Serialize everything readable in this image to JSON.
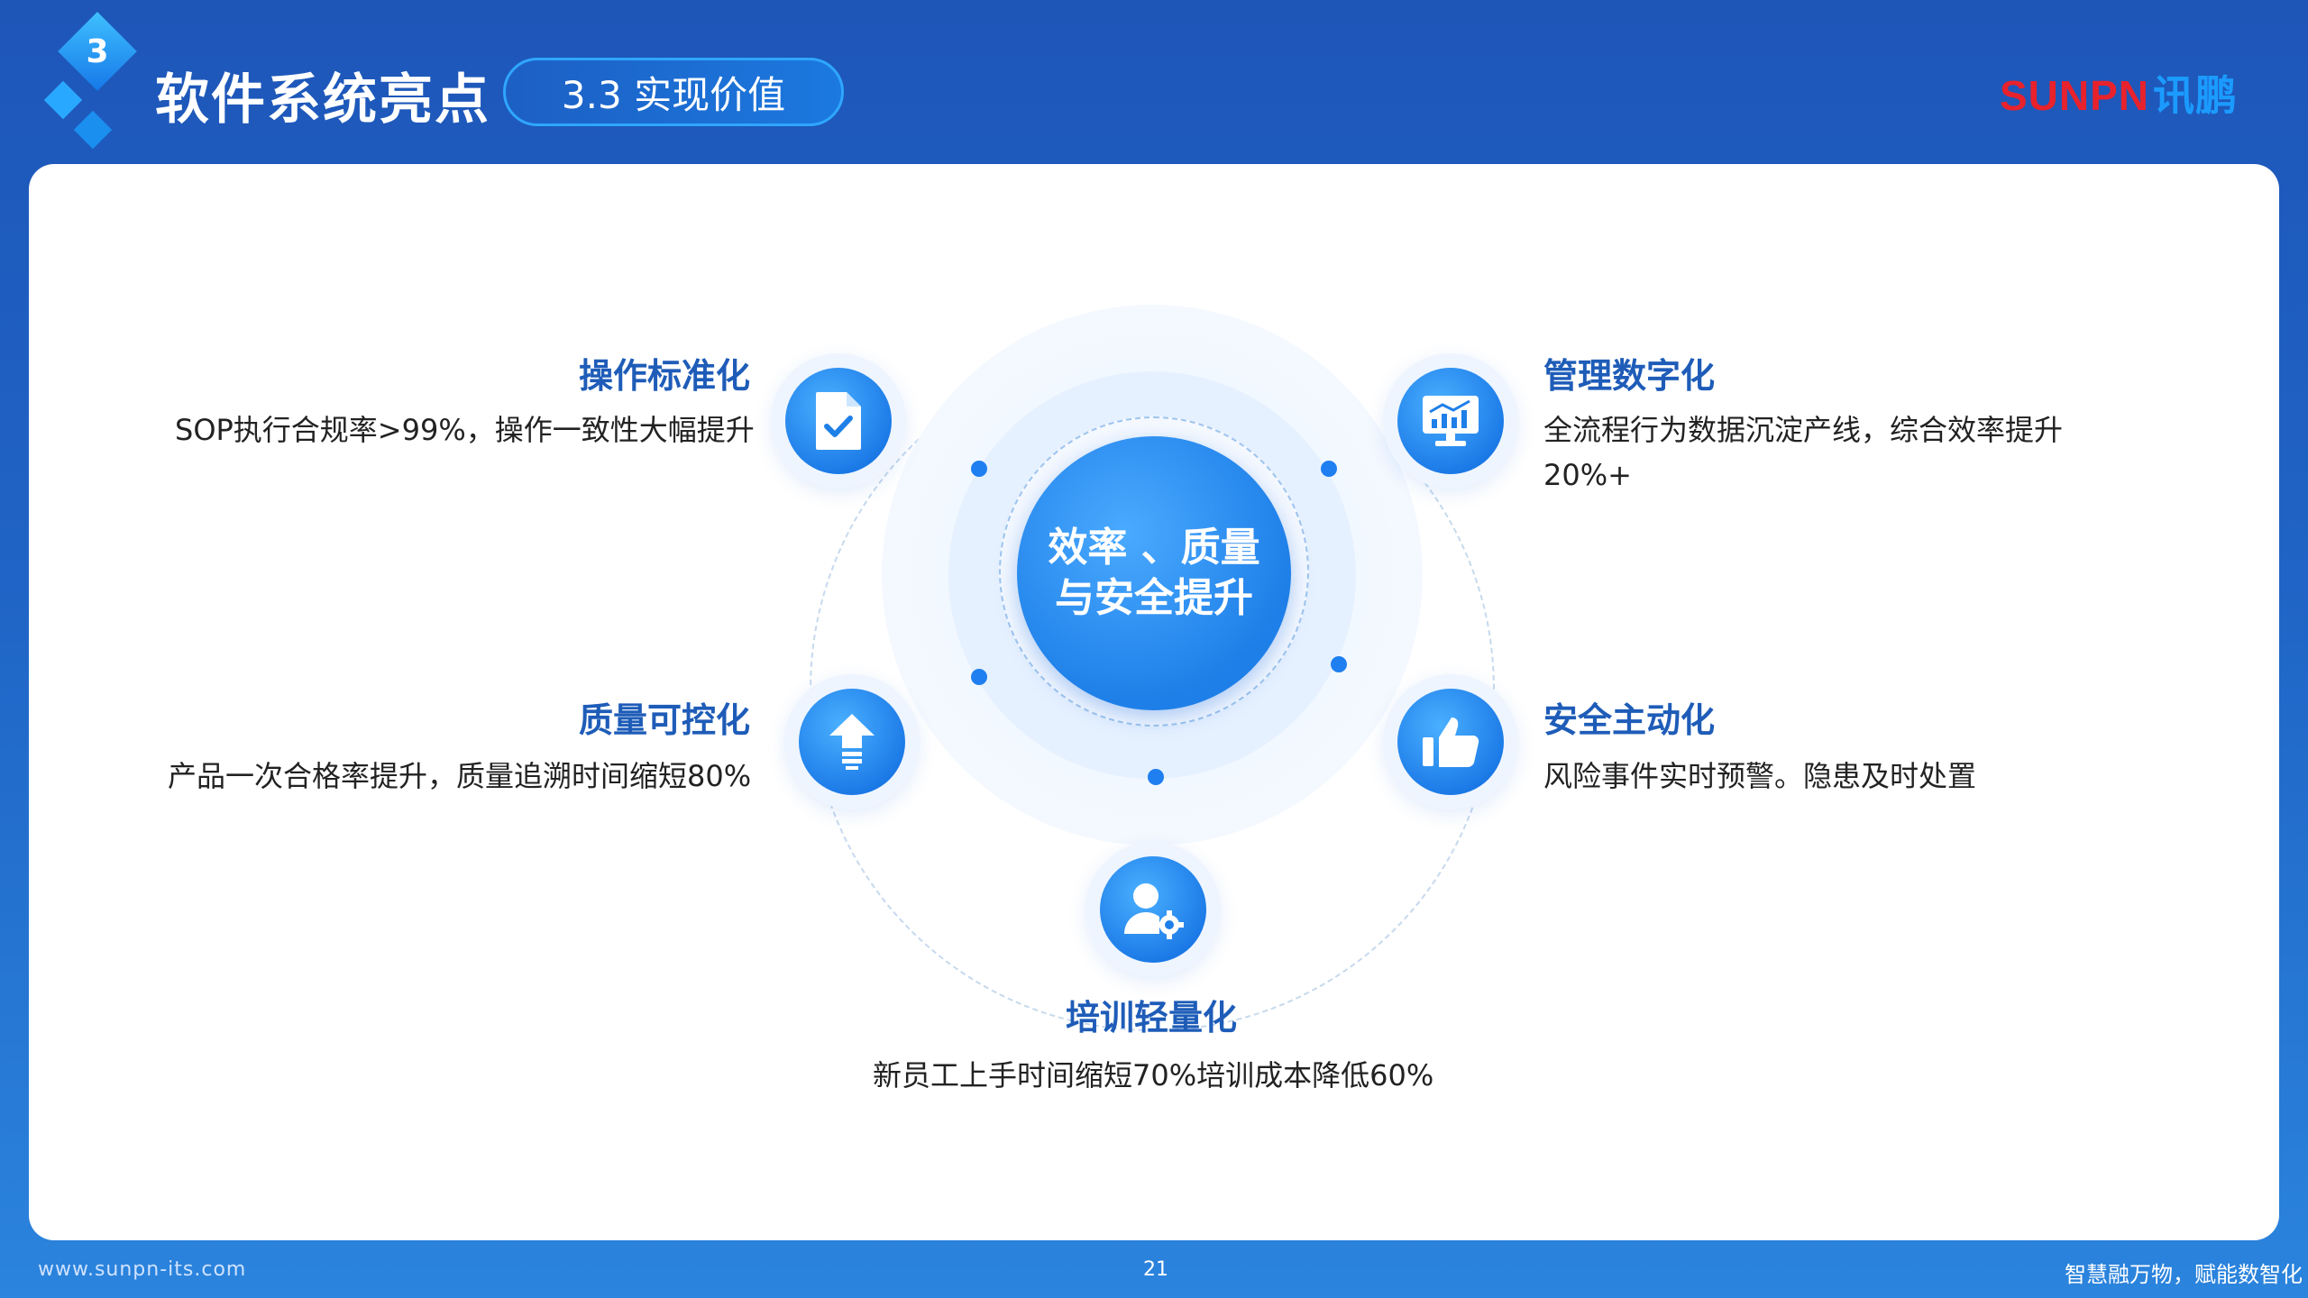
{
  "header": {
    "section_number": "3",
    "title": "软件系统亮点",
    "section_label": "3.3 实现价值",
    "logo_text": "SUNPN",
    "logo_cn": "讯鹏"
  },
  "center": {
    "line1": "效率 、质量",
    "line2": "与安全提升"
  },
  "items": [
    {
      "title": "操作标准化",
      "desc": "SOP执行合规率>99%，操作一致性大幅提升",
      "icon": "document-check-icon"
    },
    {
      "title": "管理数字化",
      "desc_line1": "全流程行为数据沉淀产线，综合效率提升",
      "desc_line2": "20%+",
      "icon": "monitor-chart-icon"
    },
    {
      "title": "质量可控化",
      "desc": "产品一次合格率提升，质量追溯时间缩短80%",
      "icon": "upload-arrow-icon"
    },
    {
      "title": "安全主动化",
      "desc": "风险事件实时预警。隐患及时处置",
      "icon": "thumbs-up-icon"
    },
    {
      "title": "培训轻量化",
      "desc": "新员工上手时间缩短70%培训成本降低60%",
      "icon": "user-gear-icon"
    }
  ],
  "footer": {
    "url": "www.sunpn-its.com",
    "page": "21",
    "slogan": "智慧融万物，赋能数智化"
  },
  "colors": {
    "accent": "#1e7fe8",
    "title_blue": "#1e5cb8",
    "logo_red": "#e8222c"
  }
}
